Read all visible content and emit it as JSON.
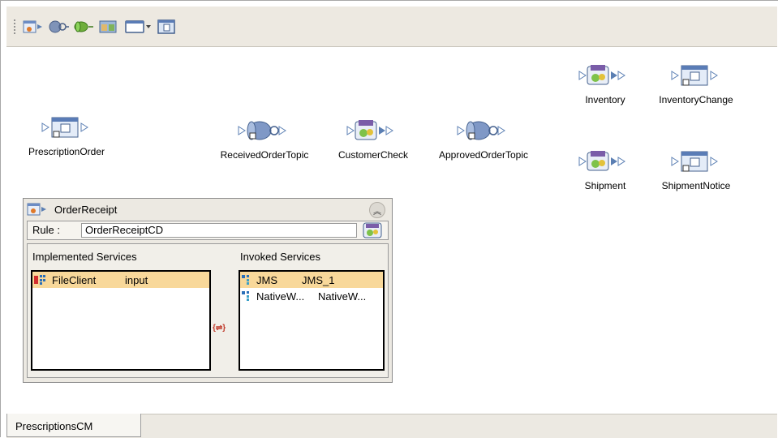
{
  "toolbar": {
    "buttons": [
      {
        "name": "add-service-icon"
      },
      {
        "name": "add-gear-service-icon"
      },
      {
        "name": "add-topic-icon"
      },
      {
        "name": "add-table-icon"
      },
      {
        "name": "add-window-dropdown-icon"
      },
      {
        "name": "add-file-icon"
      }
    ]
  },
  "nodes": {
    "prescription_order": "PrescriptionOrder",
    "received_order_topic": "ReceivedOrderTopic",
    "customer_check": "CustomerCheck",
    "approved_order_topic": "ApprovedOrderTopic",
    "inventory": "Inventory",
    "inventory_change": "InventoryChange",
    "shipment": "Shipment",
    "shipment_notice": "ShipmentNotice"
  },
  "panel": {
    "title": "OrderReceipt",
    "rule_label": "Rule :",
    "rule_value": "OrderReceiptCD",
    "implemented_header": "Implemented Services",
    "invoked_header": "Invoked Services",
    "implemented": [
      {
        "name": "FileClient",
        "value": "input",
        "selected": true
      }
    ],
    "invoked": [
      {
        "name": "JMS",
        "value": "JMS_1",
        "selected": true
      },
      {
        "name": "NativeW...",
        "value": "NativeW...",
        "selected": false
      }
    ]
  },
  "tabs": {
    "active": "PrescriptionsCM"
  },
  "colors": {
    "toolbar_bg": "#ede9e1",
    "selection": "#f8d89a",
    "panel_bg": "#ece9e2"
  }
}
